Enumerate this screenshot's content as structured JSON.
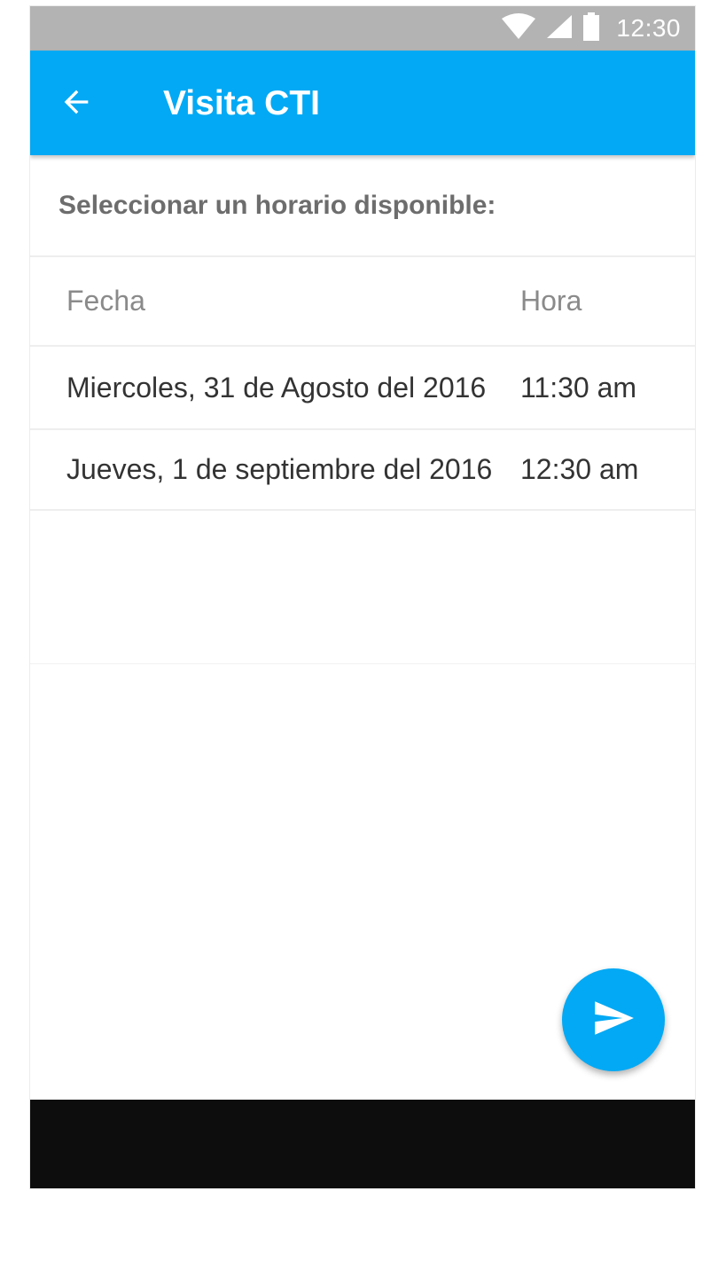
{
  "status_bar": {
    "time": "12:30",
    "icons": [
      "wifi-icon",
      "cell-signal-icon",
      "battery-icon"
    ]
  },
  "app_bar": {
    "title": "Visita CTI",
    "back_icon": "arrow-back-icon"
  },
  "section": {
    "heading": "Seleccionar un horario disponible:"
  },
  "schedule_table": {
    "columns": [
      "Fecha",
      "Hora"
    ],
    "rows": [
      {
        "date": "Miercoles, 31 de Agosto del 2016",
        "time": "11:30 am"
      },
      {
        "date": "Jueves, 1 de septiembre del 2016",
        "time": "12:30 am"
      }
    ]
  },
  "fab": {
    "icon": "send-icon"
  },
  "colors": {
    "primary": "#03a9f4",
    "status_bar": "#b3b3b3",
    "nav_bar": "#0d0d0d"
  }
}
